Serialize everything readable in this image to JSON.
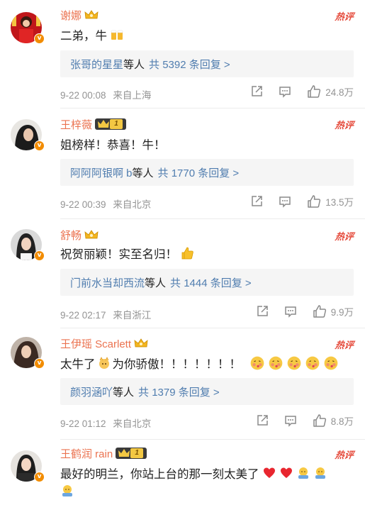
{
  "hot_label": "热评",
  "comments": [
    {
      "username": "谢娜",
      "text": "二弟，牛",
      "reply_who": "张哥的星星",
      "reply_suffix": "等人",
      "reply_count": "共 5392 条回复 >",
      "time": "9-22 00:08",
      "location": "来自上海",
      "likes": "24.8万"
    },
    {
      "username": "王梓薇",
      "text": "姐榜样！恭喜！牛！",
      "reply_who": "阿阿阿银啊 b",
      "reply_suffix": "等人",
      "reply_count": "共 1770 条回复 >",
      "time": "9-22 00:39",
      "location": "来自北京",
      "likes": "13.5万",
      "level": "1"
    },
    {
      "username": "舒畅",
      "text": "祝贺丽颖！实至名归！",
      "reply_who": "门前水当却西流",
      "reply_suffix": "等人",
      "reply_count": "共 1444 条回复 >",
      "time": "9-22 02:17",
      "location": "来自浙江",
      "likes": "9.9万"
    },
    {
      "username": "王伊瑶 Scarlett",
      "text_a": "太牛了",
      "text_b": "为你骄傲！！！！！！！",
      "reply_who": "颜羽涵吖",
      "reply_suffix": "等人",
      "reply_count": "共 1379 条回复 >",
      "time": "9-22 01:12",
      "location": "来自北京",
      "likes": "8.8万"
    },
    {
      "username": "王鹤润 rain",
      "text": "最好的明兰，你站上台的那一刻太美了",
      "level": "1"
    }
  ],
  "colors": {
    "username": "#eb7350",
    "link": "#507daf",
    "meta": "#939393",
    "hot": "#e54b3c"
  }
}
